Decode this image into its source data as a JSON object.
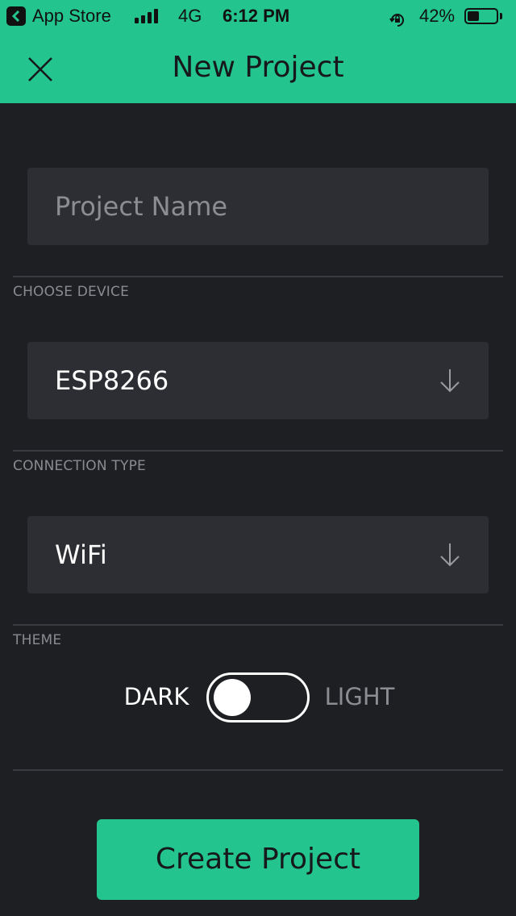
{
  "status_bar": {
    "back_app_label": "App Store",
    "network": "4G",
    "time": "6:12 PM",
    "battery_percent": "42%",
    "battery_level": 0.42
  },
  "nav": {
    "title": "New Project",
    "close_icon": "close-icon"
  },
  "form": {
    "project_name": {
      "value": "",
      "placeholder": "Project Name"
    },
    "device": {
      "label": "CHOOSE DEVICE",
      "value": "ESP8266",
      "icon": "chevron-down-icon"
    },
    "connection": {
      "label": "CONNECTION TYPE",
      "value": "WiFi",
      "icon": "chevron-down-icon"
    },
    "theme": {
      "label": "THEME",
      "option_left": "DARK",
      "option_right": "LIGHT",
      "selected": "DARK"
    }
  },
  "actions": {
    "create_label": "Create Project"
  },
  "colors": {
    "accent": "#23c48e",
    "background": "#1e1f23",
    "field": "#2d2e33",
    "muted_text": "#8c8d92"
  }
}
